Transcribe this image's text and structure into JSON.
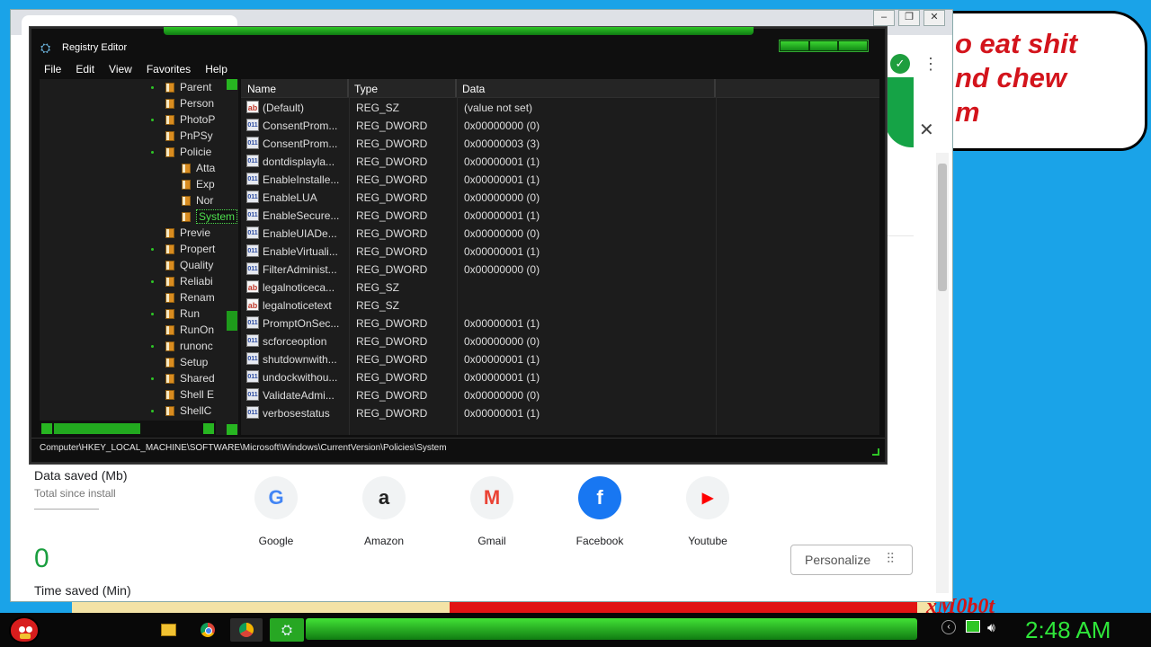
{
  "background": {
    "bubble_lines": [
      "o eat shit",
      "nd chew",
      "m"
    ],
    "bottom_text": "xM0b0t"
  },
  "browser": {
    "window_controls": [
      "–",
      "❐",
      "✕"
    ],
    "close_glyph": "✕",
    "stats": {
      "data_saved_title": "Data saved (Mb)",
      "data_saved_sub": "Total since install",
      "data_saved_value": "0",
      "time_saved_title": "Time saved (Min)"
    },
    "shortcuts": [
      {
        "label": "Google",
        "glyph": "G",
        "color": "#4285f4",
        "icon": "google-icon"
      },
      {
        "label": "Amazon",
        "glyph": "a",
        "color": "#222222",
        "icon": "amazon-icon"
      },
      {
        "label": "Gmail",
        "glyph": "M",
        "color": "#ea4335",
        "icon": "gmail-icon"
      },
      {
        "label": "Facebook",
        "glyph": "f",
        "color": "#1877f2",
        "icon": "facebook-icon"
      },
      {
        "label": "Youtube",
        "glyph": "▶",
        "color": "#ff0000",
        "icon": "youtube-icon"
      }
    ],
    "personalize_label": "Personalize"
  },
  "regedit": {
    "title": "Registry Editor",
    "menu": [
      "File",
      "Edit",
      "View",
      "Favorites",
      "Help"
    ],
    "tree": [
      {
        "label": "Parent",
        "indent": 1
      },
      {
        "label": "Person",
        "indent": 1
      },
      {
        "label": "PhotoP",
        "indent": 1
      },
      {
        "label": "PnPSy",
        "indent": 1
      },
      {
        "label": "Policie",
        "indent": 1
      },
      {
        "label": "Atta",
        "indent": 2
      },
      {
        "label": "Exp",
        "indent": 2
      },
      {
        "label": "Nor",
        "indent": 2
      },
      {
        "label": "System",
        "indent": 2,
        "selected": true
      },
      {
        "label": "Previe",
        "indent": 1
      },
      {
        "label": "Propert",
        "indent": 1
      },
      {
        "label": "Quality",
        "indent": 1
      },
      {
        "label": "Reliabi",
        "indent": 1
      },
      {
        "label": "Renam",
        "indent": 1
      },
      {
        "label": "Run",
        "indent": 1
      },
      {
        "label": "RunOn",
        "indent": 1
      },
      {
        "label": "runonc",
        "indent": 1
      },
      {
        "label": "Setup",
        "indent": 1
      },
      {
        "label": "Shared",
        "indent": 1
      },
      {
        "label": "Shell E",
        "indent": 1
      },
      {
        "label": "ShellC",
        "indent": 1
      }
    ],
    "columns": [
      "Name",
      "Type",
      "Data"
    ],
    "values": [
      {
        "name": "(Default)",
        "type": "REG_SZ",
        "data": "(value not set)",
        "kind": "sz"
      },
      {
        "name": "ConsentProm...",
        "type": "REG_DWORD",
        "data": "0x00000000 (0)",
        "kind": "dw"
      },
      {
        "name": "ConsentProm...",
        "type": "REG_DWORD",
        "data": "0x00000003 (3)",
        "kind": "dw"
      },
      {
        "name": "dontdisplayla...",
        "type": "REG_DWORD",
        "data": "0x00000001 (1)",
        "kind": "dw"
      },
      {
        "name": "EnableInstalle...",
        "type": "REG_DWORD",
        "data": "0x00000001 (1)",
        "kind": "dw"
      },
      {
        "name": "EnableLUA",
        "type": "REG_DWORD",
        "data": "0x00000000 (0)",
        "kind": "dw"
      },
      {
        "name": "EnableSecure...",
        "type": "REG_DWORD",
        "data": "0x00000001 (1)",
        "kind": "dw"
      },
      {
        "name": "EnableUIADe...",
        "type": "REG_DWORD",
        "data": "0x00000000 (0)",
        "kind": "dw"
      },
      {
        "name": "EnableVirtuali...",
        "type": "REG_DWORD",
        "data": "0x00000001 (1)",
        "kind": "dw"
      },
      {
        "name": "FilterAdminist...",
        "type": "REG_DWORD",
        "data": "0x00000000 (0)",
        "kind": "dw"
      },
      {
        "name": "legalnoticeca...",
        "type": "REG_SZ",
        "data": "",
        "kind": "sz"
      },
      {
        "name": "legalnoticetext",
        "type": "REG_SZ",
        "data": "",
        "kind": "sz"
      },
      {
        "name": "PromptOnSec...",
        "type": "REG_DWORD",
        "data": "0x00000001 (1)",
        "kind": "dw"
      },
      {
        "name": "scforceoption",
        "type": "REG_DWORD",
        "data": "0x00000000 (0)",
        "kind": "dw"
      },
      {
        "name": "shutdownwith...",
        "type": "REG_DWORD",
        "data": "0x00000001 (1)",
        "kind": "dw"
      },
      {
        "name": "undockwithou...",
        "type": "REG_DWORD",
        "data": "0x00000001 (1)",
        "kind": "dw"
      },
      {
        "name": "ValidateAdmi...",
        "type": "REG_DWORD",
        "data": "0x00000000 (0)",
        "kind": "dw"
      },
      {
        "name": "verbosestatus",
        "type": "REG_DWORD",
        "data": "0x00000001 (1)",
        "kind": "dw"
      }
    ],
    "status_path": "Computer\\HKEY_LOCAL_MACHINE\\SOFTWARE\\Microsoft\\Windows\\CurrentVersion\\Policies\\System"
  },
  "taskbar": {
    "clock": "2:48 AM",
    "accent": "#2fe63a"
  }
}
